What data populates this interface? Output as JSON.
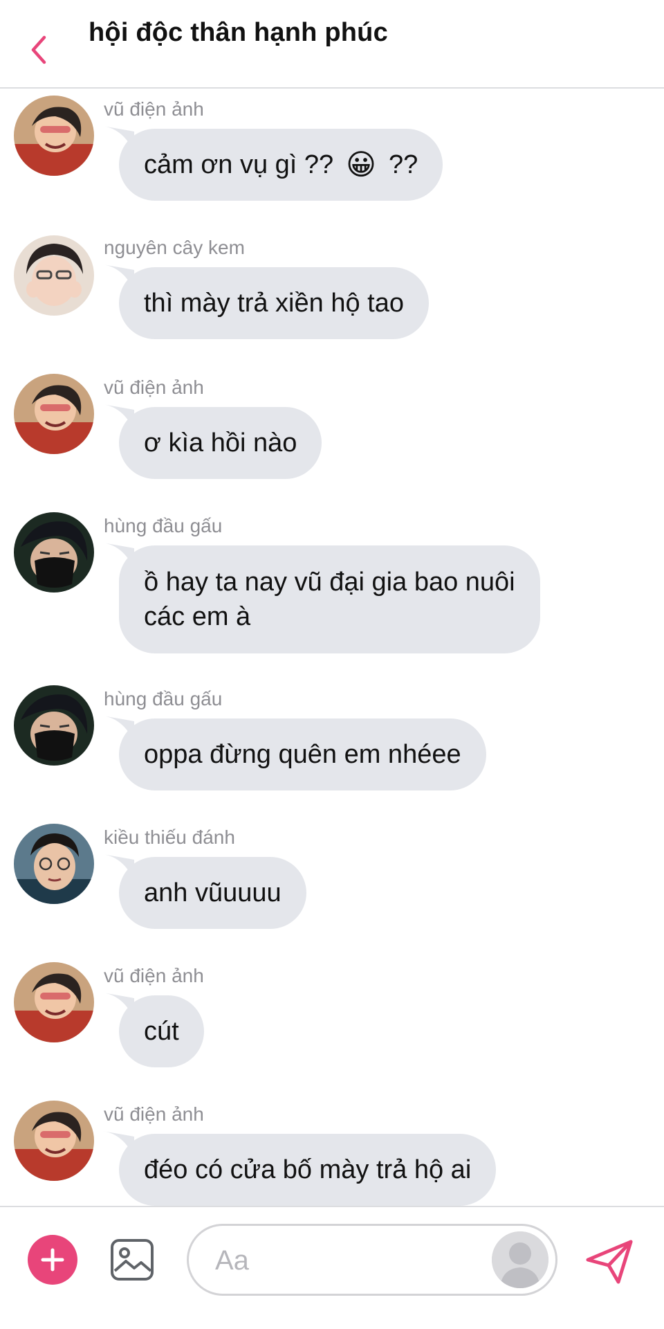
{
  "header": {
    "title": "hội độc thân hạnh phúc"
  },
  "messages": [
    {
      "sender": "vũ điện ảnh",
      "avatar": "avatar-vu",
      "lines": [
        "cảm ơn vụ gì ??",
        "😀",
        "??"
      ],
      "emoji_inline": true
    },
    {
      "sender": "nguyên cây kem",
      "avatar": "avatar-nguyen",
      "lines": [
        "thì mày trả xiền hộ tao"
      ]
    },
    {
      "sender": "vũ điện ảnh",
      "avatar": "avatar-vu",
      "lines": [
        "ơ kìa hồi nào"
      ]
    },
    {
      "sender": "hùng đầu gấu",
      "avatar": "avatar-hung",
      "lines": [
        "ồ hay ta nay vũ đại gia bao nuôi",
        "các em à"
      ]
    },
    {
      "sender": "hùng đầu gấu",
      "avatar": "avatar-hung",
      "lines": [
        "oppa đừng quên em nhéee"
      ]
    },
    {
      "sender": "kiều thiếu đánh",
      "avatar": "avatar-kieu",
      "lines": [
        "anh vũuuuu"
      ]
    },
    {
      "sender": "vũ điện ảnh",
      "avatar": "avatar-vu",
      "lines": [
        "cút"
      ]
    },
    {
      "sender": "vũ điện ảnh",
      "avatar": "avatar-vu",
      "lines": [
        "đéo có cửa bố mày trả hộ ai"
      ]
    }
  ],
  "composer": {
    "placeholder": "Aa"
  },
  "colors": {
    "accent": "#e8457a",
    "bubble": "#e4e6eb",
    "sender_text": "#8e8e93"
  },
  "icons": {
    "back": "chevron-left-icon",
    "plus": "plus-icon",
    "image": "image-icon",
    "send": "send-icon",
    "profile": "profile-silhouette-icon"
  }
}
